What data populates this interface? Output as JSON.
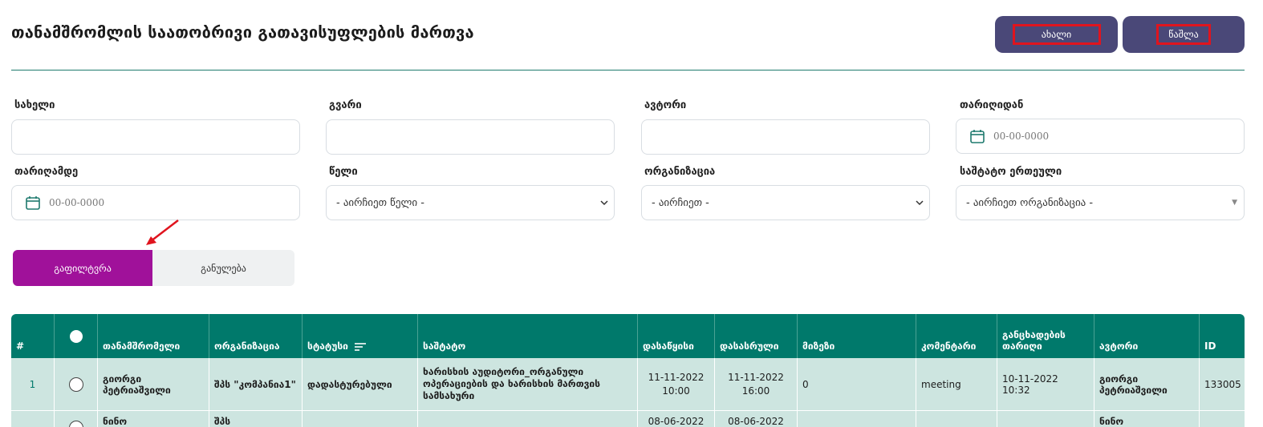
{
  "page": {
    "title": "თანამშრომლის საათობრივი გათავისუფლების მართვა"
  },
  "toolbar": {
    "new_label": "ახალი",
    "delete_label": "წაშლა"
  },
  "filters": {
    "name": {
      "label": "სახელი",
      "value": ""
    },
    "surname": {
      "label": "გვარი",
      "value": ""
    },
    "author": {
      "label": "ავტორი",
      "value": ""
    },
    "date_from": {
      "label": "თარიღიდან",
      "placeholder": "00-00-0000"
    },
    "date_to": {
      "label": "თარიღამდე",
      "placeholder": "00-00-0000"
    },
    "year": {
      "label": "წელი",
      "selected": "- აირჩიეთ წელი -"
    },
    "organization": {
      "label": "ორგანიზაცია",
      "selected": "- აირჩიეთ -"
    },
    "staff_unit": {
      "label": "საშტატო ერთეული",
      "selected": "- აირჩიეთ ორგანიზაცია -"
    }
  },
  "actions": {
    "filter_label": "გაფილტვრა",
    "reset_label": "განულება"
  },
  "table": {
    "columns": {
      "num": "#",
      "employee": "თანამშრომელი",
      "organization": "ორგანიზაცია",
      "status": "სტატუსი",
      "position": "საშტატო",
      "start": "დასაწყისი",
      "end": "დასასრული",
      "reason": "მიზეზი",
      "comment": "კომენტარი",
      "statement_date": "განცხადების თარიღი",
      "author": "ავტორი",
      "id": "ID"
    },
    "rows": [
      {
        "num": "1",
        "employee": "გიორგი პეტრიაშვილი",
        "organization": "შპს \"კომპანია1\"",
        "status": "დადასტურებული",
        "position": "ხარისხის აუდიტორი_ორგანული ოპერაციების და ხარისხის მართვის სამსახური",
        "start_date": "11-11-2022",
        "start_time": "10:00",
        "end_date": "11-11-2022",
        "end_time": "16:00",
        "reason": "0",
        "comment": "meeting",
        "statement_date": "10-11-2022 10:32",
        "author": "გიორგი პეტრიაშვილი",
        "id": "133005"
      },
      {
        "num": "",
        "employee": "ნინო",
        "organization": "შპს",
        "status": "",
        "position": "",
        "start_date": "08-06-2022",
        "end_date": "08-06-2022",
        "reason": "",
        "comment": "",
        "statement_date": "",
        "author": "ნინო",
        "id": ""
      }
    ]
  },
  "colors": {
    "accent": "#4a4878",
    "filter": "#a0119a",
    "table_header": "#00796b",
    "row_bg": "#cde5e0",
    "status_ok": "#108a2c",
    "highlight": "#e0141e"
  }
}
